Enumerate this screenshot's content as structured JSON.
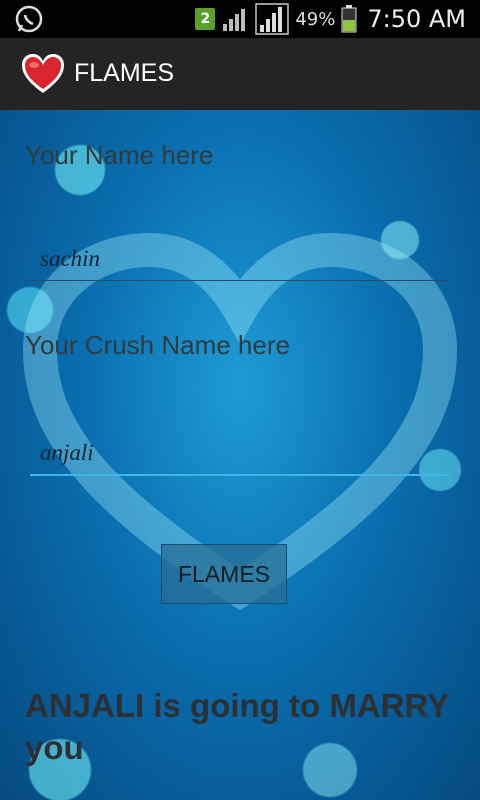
{
  "status_bar": {
    "sim_number": "2",
    "battery_percent": "49%",
    "time": "7:50 AM",
    "icons": [
      "whatsapp-icon",
      "sim-icon",
      "signal-icon",
      "signal-icon",
      "battery-icon"
    ]
  },
  "action_bar": {
    "title": "FLAMES",
    "logo_icon": "heart-icon"
  },
  "form": {
    "your_name_label": "Your Name here",
    "your_name_value": "sachin",
    "crush_name_label": "Your Crush Name here",
    "crush_name_value": "anjali",
    "button_label": "FLAMES"
  },
  "result": {
    "text": "ANJALI is going to MARRY you"
  },
  "colors": {
    "action_bar": "#242424",
    "focus_underline": "#3fb6e5",
    "background_blue": "#0a6fb0"
  }
}
